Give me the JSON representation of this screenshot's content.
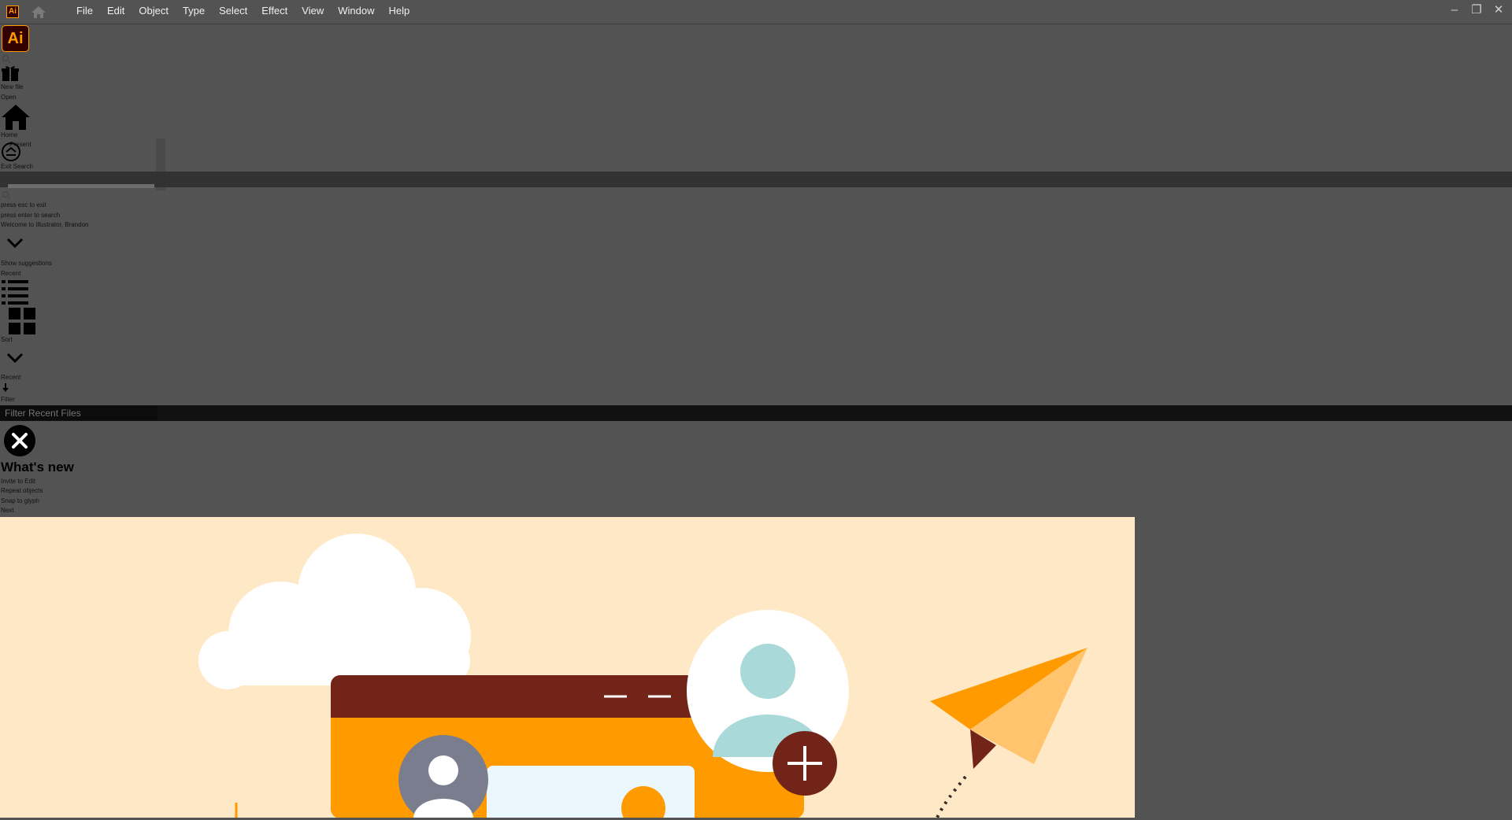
{
  "app": {
    "logo_text": "Ai",
    "menu": [
      "File",
      "Edit",
      "Object",
      "Type",
      "Select",
      "Effect",
      "View",
      "Window",
      "Help"
    ]
  },
  "window_controls": {
    "minimize": "–",
    "restore": "❐",
    "close": "✕"
  },
  "sidebar": {
    "new_file": "New file",
    "open": "Open",
    "home": "Home",
    "present": "Present",
    "exit_search": "Exit Search"
  },
  "search": {
    "press_esc": "press esc to exit",
    "press_enter": "press enter to search",
    "welcome": "Welcome to Illustrator, Brandon",
    "show_suggestions": "Show suggestions"
  },
  "recent": {
    "label": "Recent",
    "sort": "Sort",
    "sort_value": "Recent",
    "filter": "Filter",
    "filter_placeholder": "Filter Recent Files"
  },
  "whats_new": {
    "title": "What's new",
    "items": [
      "Invite to Edit",
      "Repeat objects",
      "Snap to glyph"
    ],
    "next": "Next"
  },
  "colors": {
    "background": "#535353",
    "illustration_bg": "#ffe8c5",
    "brand_orange": "#ff9a00",
    "dark_red": "#722419"
  }
}
